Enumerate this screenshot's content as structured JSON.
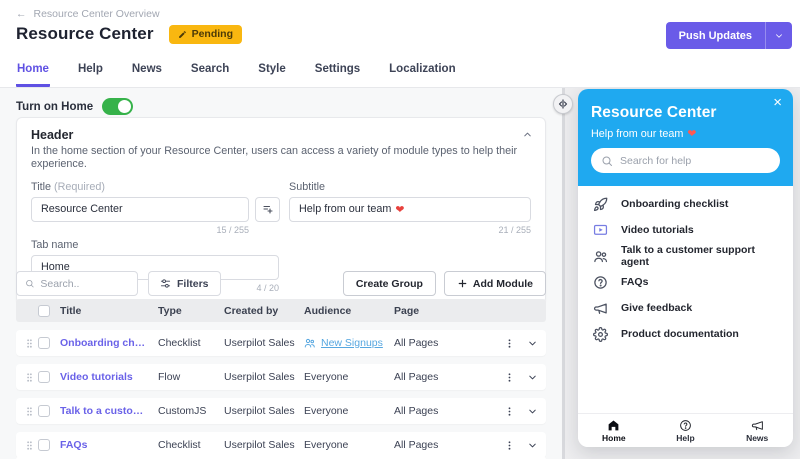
{
  "colors": {
    "accent": "#6a5be8",
    "active_tab": "#5f51e3",
    "preview_header_bg": "#1fa9f0",
    "badge_bg": "#f9b710",
    "toggle_on": "#36b24a",
    "audience_link": "#57a7e0",
    "row_title_link": "#6a62e8"
  },
  "topbar": {
    "breadcrumb": "Resource Center Overview",
    "title": "Resource Center",
    "status_badge": "Pending",
    "push_updates_label": "Push Updates"
  },
  "tabs": [
    {
      "label": "Home",
      "active": true
    },
    {
      "label": "Help"
    },
    {
      "label": "News"
    },
    {
      "label": "Search"
    },
    {
      "label": "Style"
    },
    {
      "label": "Settings"
    },
    {
      "label": "Localization"
    }
  ],
  "left": {
    "turn_on_home_label": "Turn on Home",
    "header_card": {
      "title": "Header",
      "description": "In the home section of your Resource Center, users can access a variety of module types to help their experience.",
      "title_label": "Title",
      "title_required": "(Required)",
      "title_value": "Resource Center",
      "title_counter": "15 / 255",
      "subtitle_label": "Subtitle",
      "subtitle_value": "Help from our team",
      "subtitle_heart": "❤",
      "subtitle_counter": "21 / 255",
      "tab_name_label": "Tab name",
      "tab_name_value": "Home",
      "tab_name_counter": "4 / 20"
    },
    "toolbar": {
      "search_placeholder": "Search..",
      "filters_label": "Filters",
      "create_group_label": "Create Group",
      "add_module_label": "Add Module"
    },
    "table": {
      "columns": [
        "Title",
        "Type",
        "Created by",
        "Audience",
        "Page"
      ],
      "rows": [
        {
          "title": "Onboarding checklist",
          "type": "Checklist",
          "created_by": "Userpilot Sales",
          "audience": "New Signups",
          "audience_is_segment": true,
          "page": "All Pages"
        },
        {
          "title": "Video tutorials",
          "type": "Flow",
          "created_by": "Userpilot Sales",
          "audience": "Everyone",
          "page": "All Pages"
        },
        {
          "title": "Talk to a customer supp...",
          "type": "CustomJS",
          "created_by": "Userpilot Sales",
          "audience": "Everyone",
          "page": "All Pages"
        },
        {
          "title": "FAQs",
          "type": "Checklist",
          "created_by": "Userpilot Sales",
          "audience": "Everyone",
          "page": "All Pages"
        }
      ]
    }
  },
  "preview": {
    "title": "Resource Center",
    "subtitle": "Help from our team",
    "subtitle_heart": "❤",
    "close_icon": "close-icon",
    "search_placeholder": "Search for help",
    "items": [
      {
        "icon": "rocket-icon",
        "label": "Onboarding checklist"
      },
      {
        "icon": "video-icon",
        "label": "Video tutorials"
      },
      {
        "icon": "support-agent-icon",
        "label": "Talk to a customer support agent"
      },
      {
        "icon": "question-icon",
        "label": "FAQs"
      },
      {
        "icon": "megaphone-icon",
        "label": "Give feedback"
      },
      {
        "icon": "gear-icon",
        "label": "Product documentation"
      }
    ],
    "nav": [
      {
        "icon": "home-icon",
        "label": "Home",
        "active": true
      },
      {
        "icon": "help-icon",
        "label": "Help"
      },
      {
        "icon": "news-icon",
        "label": "News"
      }
    ]
  }
}
